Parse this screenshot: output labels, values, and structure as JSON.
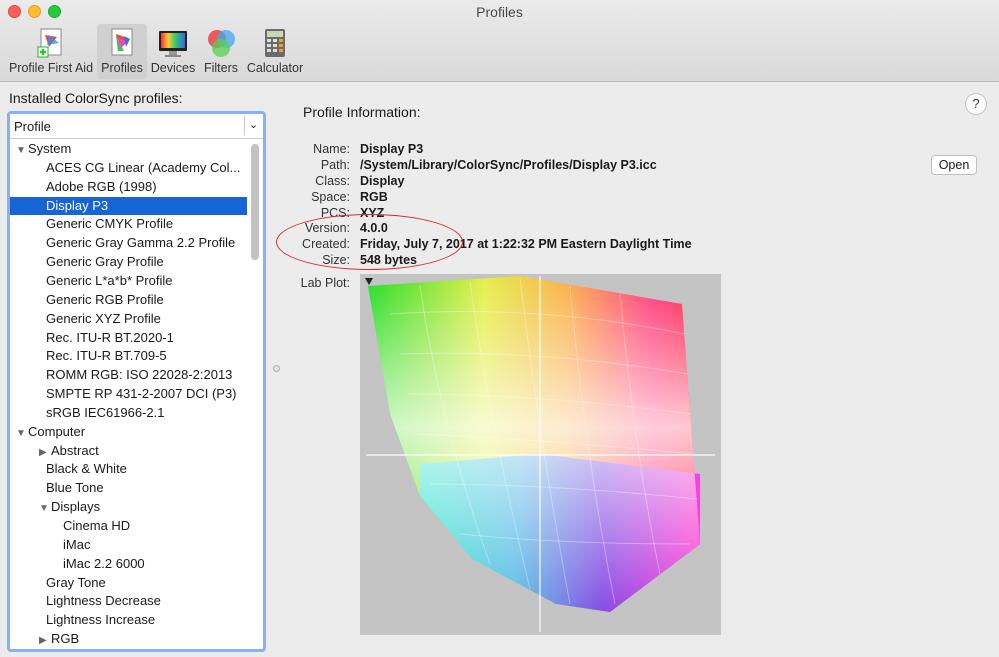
{
  "window": {
    "title": "Profiles"
  },
  "toolbar": [
    {
      "label": "Profile First Aid",
      "icon": "profile-first-aid-icon"
    },
    {
      "label": "Profiles",
      "icon": "profiles-icon",
      "active": true
    },
    {
      "label": "Devices",
      "icon": "devices-icon"
    },
    {
      "label": "Filters",
      "icon": "filters-icon"
    },
    {
      "label": "Calculator",
      "icon": "calculator-icon"
    }
  ],
  "left": {
    "heading": "Installed ColorSync profiles:",
    "column_header": "Profile",
    "rows": [
      {
        "label": "System",
        "level": 0,
        "disclosure": "open"
      },
      {
        "label": "ACES CG Linear (Academy Col...",
        "level": 1
      },
      {
        "label": "Adobe RGB (1998)",
        "level": 1
      },
      {
        "label": "Display P3",
        "level": 1,
        "selected": true
      },
      {
        "label": "Generic CMYK Profile",
        "level": 1
      },
      {
        "label": "Generic Gray Gamma 2.2 Profile",
        "level": 1
      },
      {
        "label": "Generic Gray Profile",
        "level": 1
      },
      {
        "label": "Generic L*a*b* Profile",
        "level": 1
      },
      {
        "label": "Generic RGB Profile",
        "level": 1
      },
      {
        "label": "Generic XYZ Profile",
        "level": 1
      },
      {
        "label": "Rec. ITU-R BT.2020-1",
        "level": 1
      },
      {
        "label": "Rec. ITU-R BT.709-5",
        "level": 1
      },
      {
        "label": "ROMM RGB: ISO 22028-2:2013",
        "level": 1
      },
      {
        "label": "SMPTE RP 431-2-2007 DCI (P3)",
        "level": 1
      },
      {
        "label": "sRGB IEC61966-2.1",
        "level": 1
      },
      {
        "label": "Computer",
        "level": 0,
        "disclosure": "open"
      },
      {
        "label": "Abstract",
        "level": 1,
        "disclosure": "closed"
      },
      {
        "label": "Black & White",
        "level": 1
      },
      {
        "label": "Blue Tone",
        "level": 1
      },
      {
        "label": "Displays",
        "level": 1,
        "disclosure": "open"
      },
      {
        "label": "Cinema HD",
        "level": 2
      },
      {
        "label": "iMac",
        "level": 2
      },
      {
        "label": "iMac 2.2 6000",
        "level": 2
      },
      {
        "label": "Gray Tone",
        "level": 1
      },
      {
        "label": "Lightness Decrease",
        "level": 1
      },
      {
        "label": "Lightness Increase",
        "level": 1
      },
      {
        "label": "RGB",
        "level": 1,
        "disclosure": "closed"
      }
    ]
  },
  "info": {
    "title": "Profile Information:",
    "help": "?",
    "open_button": "Open",
    "fields": [
      {
        "label": "Name:",
        "value": "Display P3"
      },
      {
        "label": "Path:",
        "value": "/System/Library/ColorSync/Profiles/Display P3.icc"
      },
      {
        "label": "Class:",
        "value": "Display"
      },
      {
        "label": "Space:",
        "value": "RGB"
      },
      {
        "label": "PCS:",
        "value": "XYZ"
      },
      {
        "label": "Version:",
        "value": "4.0.0"
      },
      {
        "label": "Created:",
        "value": "Friday, July 7, 2017 at 1:22:32 PM Eastern Daylight Time"
      },
      {
        "label": "Size:",
        "value": "548 bytes"
      }
    ],
    "plot_label": "Lab Plot:"
  },
  "colors": {
    "selection": "#1764d7",
    "focus_ring": "#8cb1ea",
    "annotation": "#d12a2a"
  }
}
